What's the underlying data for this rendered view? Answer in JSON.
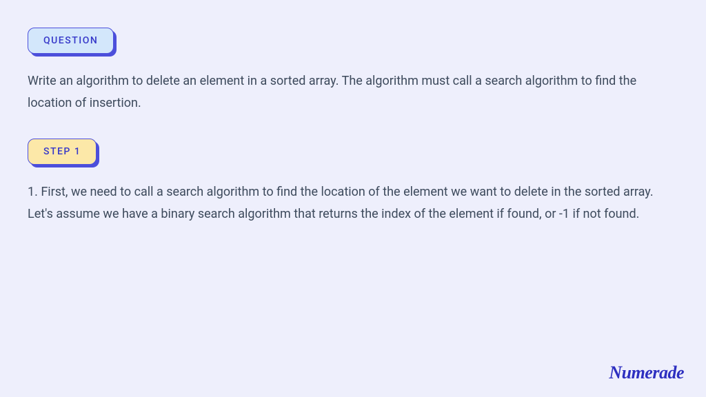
{
  "question": {
    "label": "QUESTION",
    "text": "Write an algorithm to delete an element in a sorted array. The algorithm must call a search algorithm to find the location of insertion."
  },
  "step": {
    "label": "STEP 1",
    "text": "1. First, we need to call a search algorithm to find the location of the element we want to delete in the sorted array. Let's assume we have a binary search algorithm that returns the index of the element if found, or -1 if not found."
  },
  "brand": "Numerade"
}
